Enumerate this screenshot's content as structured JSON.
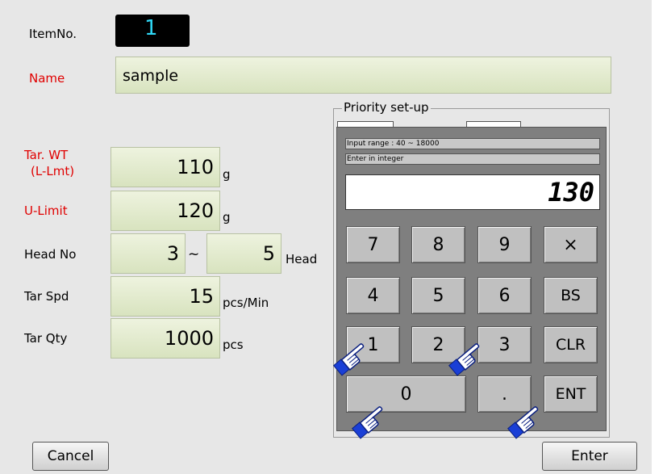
{
  "form": {
    "itemno_label": "ItemNo.",
    "itemno_value": "1",
    "name_label": "Name",
    "name_value": "sample",
    "tarwt_label_line1": "Tar. WT",
    "tarwt_label_line2": "(L-Lmt)",
    "tarwt_value": "110",
    "tarwt_unit": "g",
    "ulimit_label": "U-Limit",
    "ulimit_value": "120",
    "ulimit_unit": "g",
    "headno_label": "Head No",
    "headno_from": "3",
    "headno_sep": "~",
    "headno_to": "5",
    "headno_unit": "Head",
    "tarspd_label": "Tar Spd",
    "tarspd_value": "15",
    "tarspd_unit": "pcs/Min",
    "tarqty_label": "Tar Qty",
    "tarqty_value": "1000",
    "tarqty_unit": "pcs",
    "priority_label": "Priority set-up"
  },
  "keypad": {
    "range_text": "Input range : 40 ~ 18000",
    "hint_text": "Enter in integer",
    "display_value": "130",
    "keys": {
      "k7": "7",
      "k8": "8",
      "k9": "9",
      "kx": "×",
      "k4": "4",
      "k5": "5",
      "k6": "6",
      "kbs": "BS",
      "k1": "1",
      "k2": "2",
      "k3": "3",
      "kclr": "CLR",
      "k0": "0",
      "kdot": ".",
      "kent": "ENT"
    }
  },
  "buttons": {
    "cancel": "Cancel",
    "enter": "Enter"
  },
  "colors": {
    "background": "#e7e7e7",
    "label_red": "#e00000",
    "field_green": "#e3ebce",
    "keypad_panel": "#7f7f7f",
    "key_gray": "#c0c0c0",
    "itemno_bg": "#000000",
    "itemno_text": "#2fd7f5",
    "hand_blue": "#1a3fd6"
  },
  "icons": {
    "hand_cursor": "pointing-hand-icon"
  }
}
